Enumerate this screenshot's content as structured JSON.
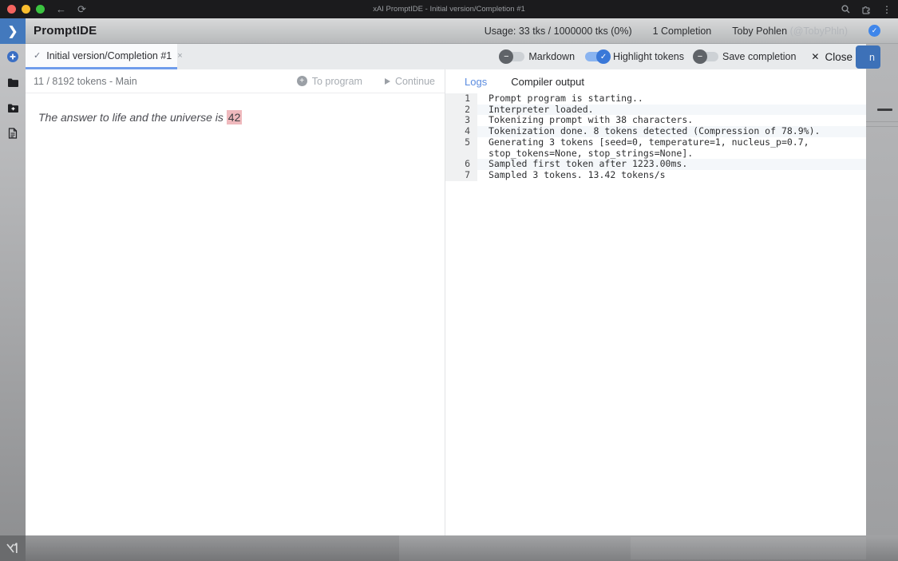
{
  "browser": {
    "title": "xAI PromptIDE - Initial version/Completion #1",
    "icons": [
      "back-arrow",
      "reload",
      "search",
      "extensions",
      "kebab-menu"
    ]
  },
  "header": {
    "app_title": "PromptIDE",
    "usage": "Usage: 33 tks / 1000000 tks (0%)",
    "completions": "1 Completion",
    "user_name": "Toby Pohlen",
    "user_handle": "(@TobyPhln)",
    "verified_check": "✓"
  },
  "sidebar": {
    "icons": [
      "add-circle",
      "folder",
      "folder-new",
      "file"
    ]
  },
  "tab_bar": {
    "active_tab": "Initial version/Completion #1",
    "tab_check": "✓",
    "tab_close": "×",
    "toggles": [
      {
        "label": "Markdown",
        "state": "off"
      },
      {
        "label": "Highlight tokens",
        "state": "on"
      },
      {
        "label": "Save completion",
        "state": "off"
      }
    ],
    "close_label": "Close",
    "close_x": "✕",
    "run_button_visible_text": "n"
  },
  "editor": {
    "status": "11 / 8192 tokens - Main",
    "to_program_label": "To program",
    "continue_label": "Continue",
    "prompt_text": "The answer to life and the universe is ",
    "highlighted_token": "42"
  },
  "output_panel": {
    "tabs": [
      "Logs",
      "Compiler output"
    ],
    "active_tab": "Logs",
    "log_lines": [
      {
        "num": "1",
        "text": "Prompt program is starting.."
      },
      {
        "num": "2",
        "text": "Interpreter loaded."
      },
      {
        "num": "3",
        "text": "Tokenizing prompt with 38 characters."
      },
      {
        "num": "4",
        "text": "Tokenization done. 8 tokens detected (Compression of 78.9%)."
      },
      {
        "num": "5",
        "text": "Generating 3 tokens [seed=0, temperature=1, nucleus_p=0.7, stop_tokens=None, stop_strings=None]."
      },
      {
        "num": "6",
        "text": "Sampled first token after 1223.00ms."
      },
      {
        "num": "7",
        "text": "Sampled 3 tokens. 13.42 tokens/s"
      }
    ]
  },
  "colors": {
    "accent_blue": "#4379bd",
    "toggle_on_track": "#8ab4f0",
    "toggle_on_knob": "#3a78d8",
    "token_highlight": "#efb9bd",
    "tab_underline": "#6f9ceb",
    "logs_active_tab": "#5b8ce0"
  }
}
